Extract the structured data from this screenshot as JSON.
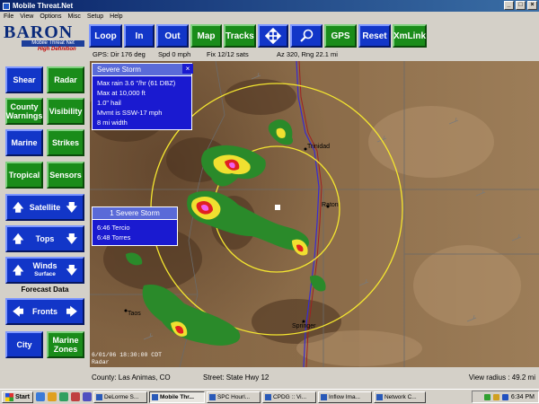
{
  "window": {
    "title": "Mobile Threat.Net"
  },
  "menu": [
    "File",
    "View",
    "Options",
    "Misc",
    "Setup",
    "Help"
  ],
  "logo": {
    "brand": "BARON",
    "product": "Mobile Threat Net",
    "edition": "High Definition"
  },
  "toolbar": {
    "buttons": [
      "Loop",
      "In",
      "Out",
      "Map",
      "Tracks",
      "GPS",
      "Reset",
      "XmLink"
    ],
    "pan_icon": "four-arrows-move-icon",
    "zoom_icon": "magnifier-icon"
  },
  "status": {
    "gps": "GPS: Dir 176 deg",
    "speed": "Spd 0 mph",
    "fix": "Fix 12/12 sats",
    "azimuth": "Az 320, Rng 22.1 mi"
  },
  "sidebar": {
    "shear": "Shear",
    "radar": "Radar",
    "county_warnings": "County Warnings",
    "visibility": "Visibility",
    "marine": "Marine",
    "strikes": "Strikes",
    "tropical": "Tropical",
    "sensors": "Sensors",
    "satellite": "Satellite",
    "tops": "Tops",
    "winds": "Winds",
    "winds_sub": "Surface",
    "forecast_header": "Forecast Data",
    "fronts": "Fronts",
    "city": "City",
    "marine_zones": "Marine Zones"
  },
  "storm_popup": {
    "title": "Severe Storm",
    "lines": [
      "Max rain 3.6 \"/hr (61 DBZ)",
      "Max at 10,000 ft",
      "1.0\" hail",
      "Mvmt is SSW-17 mph",
      "8 mi width"
    ]
  },
  "storm_count_popup": {
    "title": "1 Severe Storm",
    "lines": [
      "6:46 Tercio",
      "6:48 Torres"
    ]
  },
  "map": {
    "towns": [
      "Trinidad",
      "Raton",
      "Taos",
      "Springer"
    ],
    "timestamp": "6/01/06 18:30:00 CDT",
    "layer": "Radar"
  },
  "info": {
    "county": "County: Las Animas, CO",
    "street": "Street: State Hwy 12",
    "view_radius": "View radius : 49.2 mi"
  },
  "taskbar": {
    "start": "Start",
    "tasks": [
      "DeLorme S...",
      "Mobile Thr...",
      "SPC Hourl...",
      "CPDG :: Vi...",
      "Inflow Ima...",
      "Network C..."
    ],
    "clock": "6:34 PM"
  }
}
